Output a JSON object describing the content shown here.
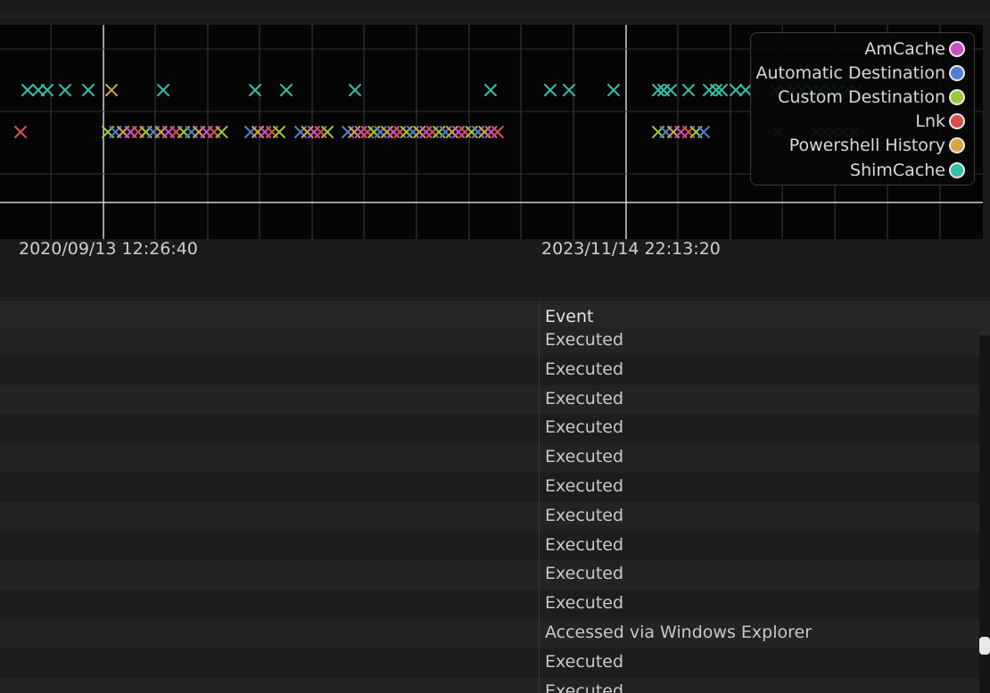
{
  "timeline": {
    "axis_labels": [
      "2020/09/13 12:26:40",
      "2023/11/14 22:13:20"
    ],
    "legend": [
      {
        "label": "AmCache",
        "color": "#c94fc6"
      },
      {
        "label": "Automatic Destination",
        "color": "#4f7fd0"
      },
      {
        "label": "Custom Destination",
        "color": "#9ac93b"
      },
      {
        "label": "Lnk",
        "color": "#d65050"
      },
      {
        "label": "Powershell History",
        "color": "#d8a442"
      },
      {
        "label": "ShimCache",
        "color": "#35bfa7"
      }
    ]
  },
  "table": {
    "header_event": "Event",
    "rows": [
      "Executed",
      "Executed",
      "Executed",
      "Executed",
      "Executed",
      "Executed",
      "Executed",
      "Executed",
      "Executed",
      "Executed",
      "Accessed via Windows Explorer",
      "Executed",
      "Executed"
    ]
  }
}
